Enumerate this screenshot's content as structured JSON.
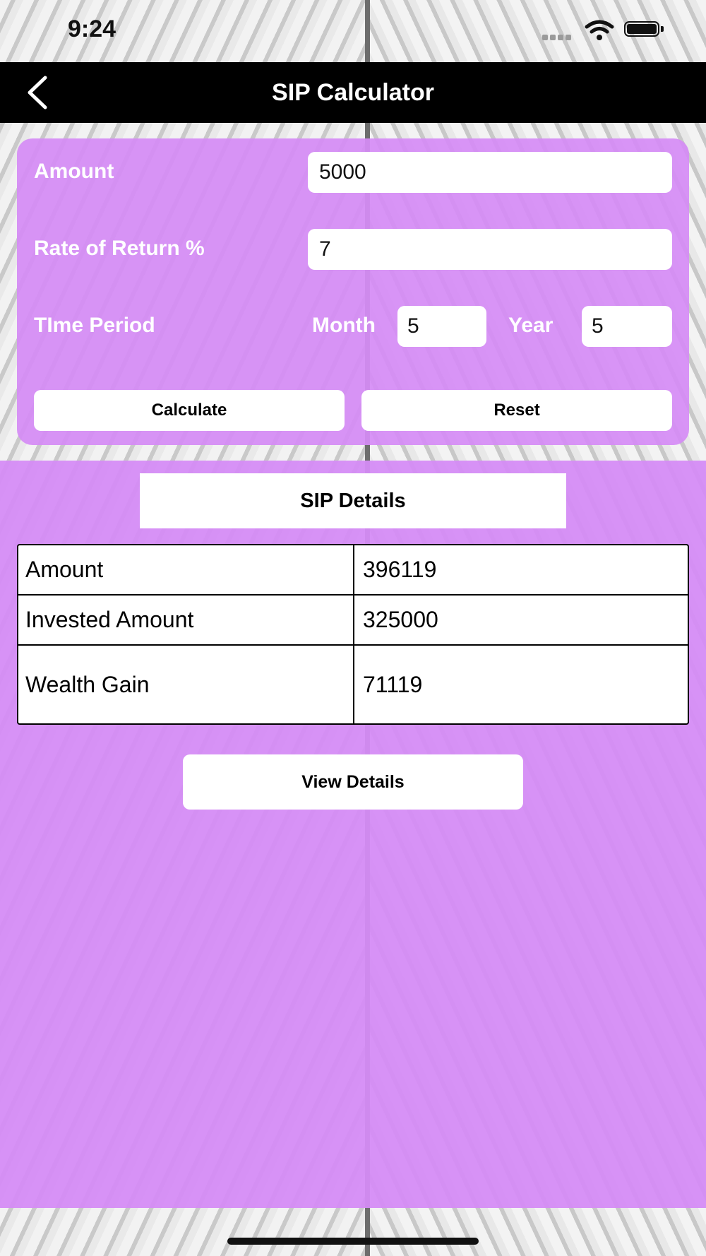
{
  "status_bar": {
    "time": "9:24"
  },
  "navbar": {
    "title": "SIP Calculator"
  },
  "form": {
    "amount_label": "Amount",
    "amount_value": "5000",
    "rate_label": "Rate of Return %",
    "rate_value": "7",
    "time_label": "TIme Period",
    "month_label": "Month",
    "month_value": "5",
    "year_label": "Year",
    "year_value": "5",
    "calculate_label": "Calculate",
    "reset_label": "Reset"
  },
  "results": {
    "heading": "SIP Details",
    "rows": [
      {
        "label": "Amount",
        "value": "396119"
      },
      {
        "label": "Invested Amount",
        "value": "325000"
      },
      {
        "label": "Wealth Gain",
        "value": "71119"
      }
    ],
    "view_details_label": "View Details"
  },
  "colors": {
    "panel": "#d58cf5",
    "navbar": "#000000"
  }
}
